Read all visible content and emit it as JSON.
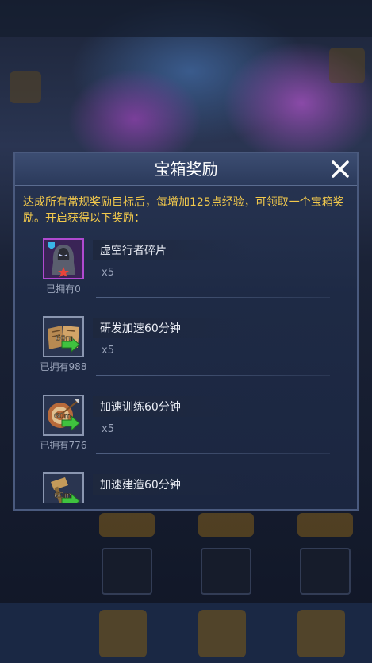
{
  "dialog": {
    "title": "宝箱奖励",
    "description": "达成所有常规奖励目标后，每增加125点经验，可领取一个宝箱奖励。开启获得以下奖励："
  },
  "rewards": [
    {
      "name": "虚空行者碎片",
      "quantity": "x5",
      "owned": "已拥有0",
      "icon": "void-walker-shard-icon"
    },
    {
      "name": "研发加速60分钟",
      "quantity": "x5",
      "owned": "已拥有988",
      "icon": "research-speedup-icon",
      "badge": "60m"
    },
    {
      "name": "加速训练60分钟",
      "quantity": "x5",
      "owned": "已拥有776",
      "icon": "training-speedup-icon",
      "badge": "60m"
    },
    {
      "name": "加速建造60分钟",
      "quantity": "",
      "owned": "",
      "icon": "build-speedup-icon",
      "badge": "60m"
    }
  ],
  "colors": {
    "description_text": "#f2c94c",
    "panel_background": "#1e2a45",
    "panel_border": "#4a5a7e"
  }
}
